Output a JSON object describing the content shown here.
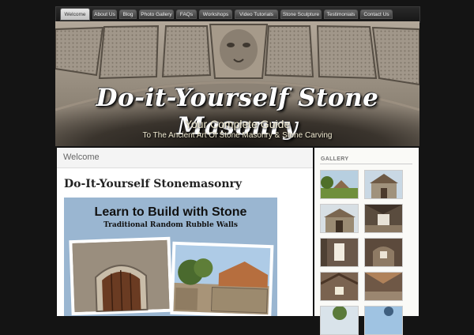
{
  "nav": {
    "items": [
      "Welcome",
      "About Us",
      "Blog",
      "Photo Gallery",
      "FAQs",
      "Workshops",
      "Video Tutorials",
      "Stone Sculpture",
      "Testimonials",
      "Contact Us"
    ],
    "active_index": 0
  },
  "banner": {
    "title": "Do-it-Yourself Stone Masonry",
    "subtitle": "Your Complete Guide",
    "tagline": "To The Ancient Art Of Stone Masonry & Stone Carving"
  },
  "main": {
    "breadcrumb": "Welcome",
    "post_title": "Do-It-Yourself Stonemasonry",
    "promo": {
      "headline": "Learn to Build with Stone",
      "subheadline": "Traditional Random Rubble Walls"
    }
  },
  "sidebar": {
    "gallery_title": "GALLERY",
    "thumbnails": [
      "garden-cottage-photo",
      "stone-house-photo",
      "stone-shed-photo",
      "stone-interior-photo",
      "stone-window-interior-photo",
      "stone-arch-interior-photo",
      "timber-roof-interior-photo",
      "stone-room-photo",
      "exterior-trees-photo",
      "exterior-sky-photo"
    ]
  },
  "colors": {
    "page_background": "#141414",
    "nav_background": "#1e1e1e",
    "content_background": "#ffffff",
    "promo_background": "#9ab6d1"
  }
}
